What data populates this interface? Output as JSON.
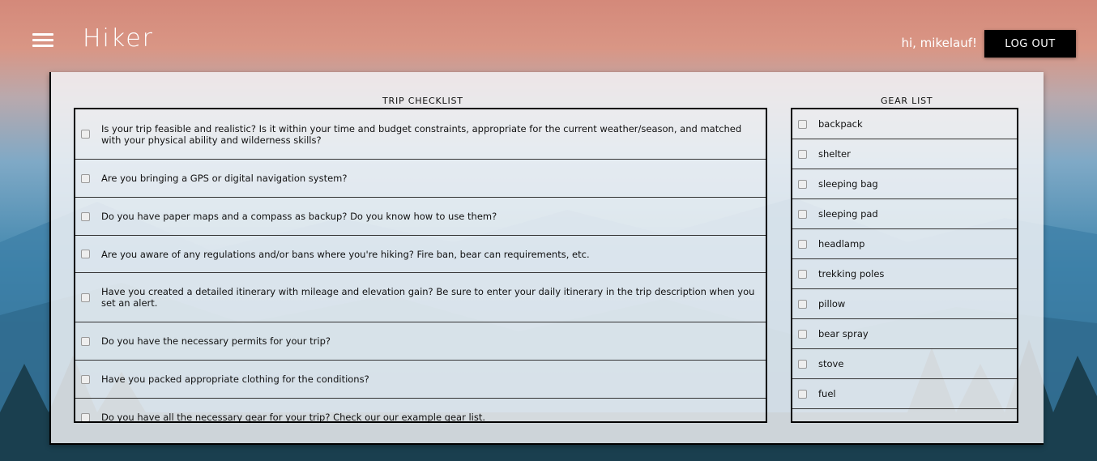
{
  "header": {
    "brand": "Hiker",
    "greeting": "hi, mikelauf!",
    "logout_label": "LOG OUT",
    "menu_icon": "hamburger-menu-icon"
  },
  "trip_checklist": {
    "title": "TRIP CHECKLIST",
    "items": [
      "Is your trip feasible and realistic? Is it within your time and budget constraints, appropriate for the current weather/season, and matched with your physical ability and wilderness skills?",
      "Are you bringing a GPS or digital navigation system?",
      "Do you have paper maps and a compass as backup? Do you know how to use them?",
      "Are you aware of any regulations and/or bans where you're hiking? Fire ban, bear can requirements, etc.",
      "Have you created a detailed itinerary with mileage and elevation gain? Be sure to enter your daily itinerary in the trip description when you set an alert.",
      "Do you have the necessary permits for your trip?",
      "Have you packed appropriate clothing for the conditions?",
      "Do you have all the necessary gear for your trip? Check our our example gear list."
    ]
  },
  "gear_list": {
    "title": "GEAR LIST",
    "items": [
      "backpack",
      "shelter",
      "sleeping bag",
      "sleeping pad",
      "headlamp",
      "trekking poles",
      "pillow",
      "bear spray",
      "stove",
      "fuel"
    ]
  }
}
